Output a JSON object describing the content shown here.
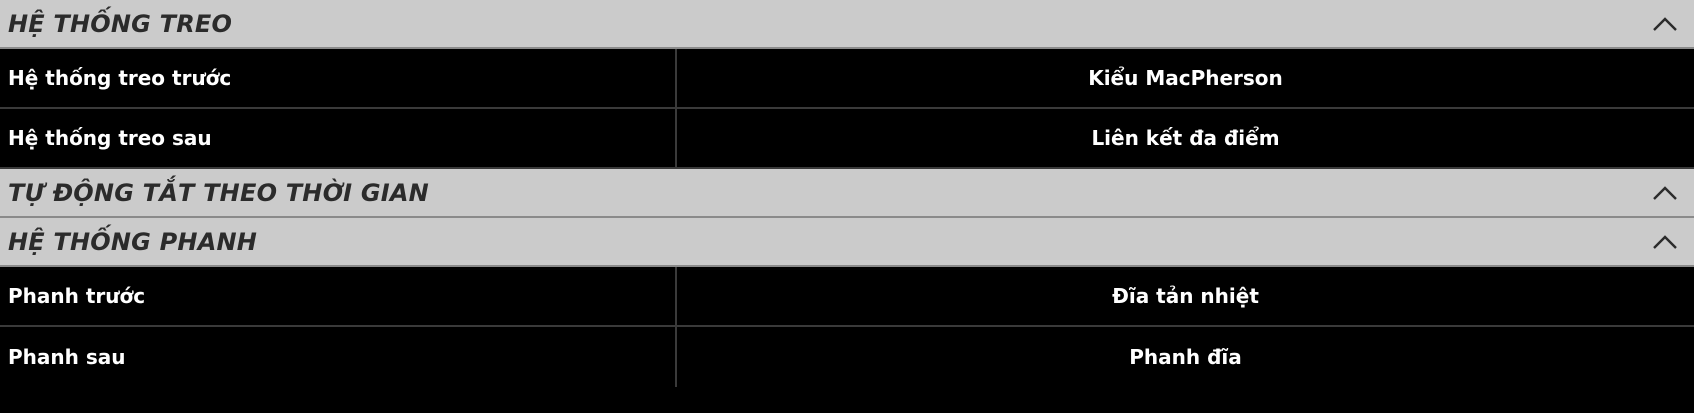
{
  "sections": [
    {
      "title": "HỆ THỐNG TREO",
      "toggle_icon": "chevron-up-icon",
      "rows": [
        {
          "label": "Hệ thống treo trước",
          "value": "Kiểu MacPherson"
        },
        {
          "label": "Hệ thống treo sau",
          "value": "Liên kết đa điểm"
        }
      ]
    },
    {
      "title": "TỰ ĐỘNG TẮT THEO THỜI GIAN",
      "toggle_icon": "chevron-up-icon",
      "rows": []
    },
    {
      "title": "HỆ THỐNG PHANH",
      "toggle_icon": "chevron-up-icon",
      "rows": [
        {
          "label": "Phanh trước",
          "value": "Đĩa tản nhiệt"
        },
        {
          "label": "Phanh sau",
          "value": "Phanh đĩa"
        }
      ]
    }
  ],
  "colors": {
    "header_bg": "#cbcbcb",
    "header_text": "#2b2b2b",
    "row_bg": "#000000",
    "row_text": "#ffffff",
    "divider": "#3a3a3a"
  }
}
